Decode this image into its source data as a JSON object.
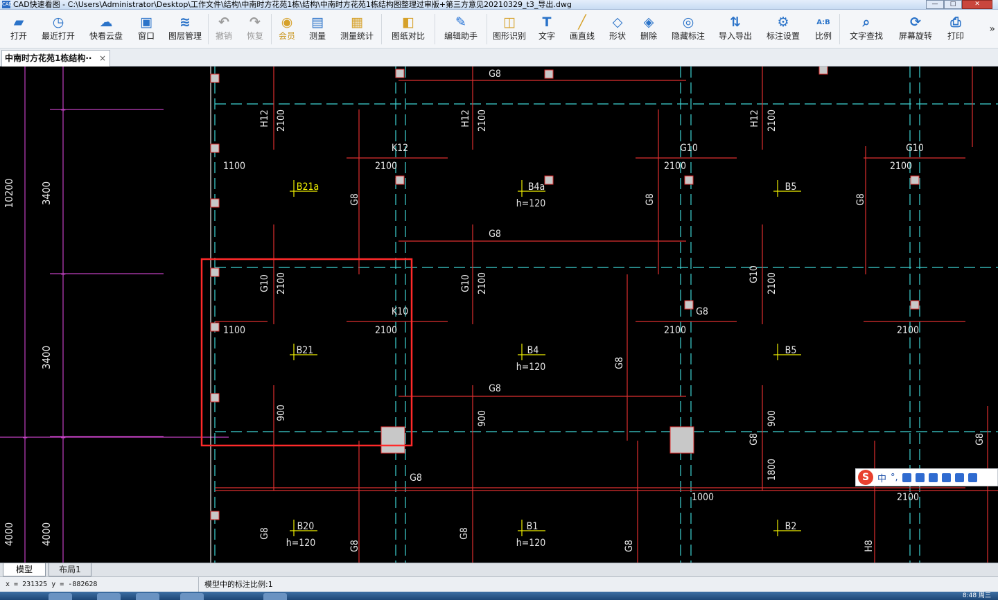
{
  "window": {
    "title": "CAD快速看图 - C:\\Users\\Administrator\\Desktop\\工作文件\\结构\\中南时方花苑1栋\\结构\\中南时方花苑1栋结构图整理过审版+第三方意见20210329_t3_导出.dwg",
    "app_icon": "CAD",
    "minimize": "—",
    "maximize": "□",
    "close": "✕"
  },
  "toolbar": [
    {
      "id": "open",
      "label": "打开",
      "icon": "folder-icon",
      "color": "#2a73c9"
    },
    {
      "id": "recent",
      "label": "最近打开",
      "icon": "history-icon",
      "color": "#2a73c9"
    },
    {
      "id": "cloud",
      "label": "快看云盘",
      "icon": "cloud-icon",
      "color": "#2a73c9"
    },
    {
      "id": "window",
      "label": "窗口",
      "icon": "window-icon",
      "color": "#2a73c9"
    },
    {
      "id": "layers",
      "label": "图层管理",
      "icon": "layers-icon",
      "color": "#2a73c9"
    },
    {
      "id": "undo",
      "label": "撤销",
      "icon": "undo-icon",
      "color": "#9a9a9a",
      "disabled": true
    },
    {
      "id": "redo",
      "label": "恢复",
      "icon": "redo-icon",
      "color": "#9a9a9a",
      "disabled": true
    },
    {
      "id": "vip",
      "label": "会员",
      "icon": "vip-icon",
      "color": "#d6a12a"
    },
    {
      "id": "measure",
      "label": "测量",
      "icon": "ruler-icon",
      "color": "#2a73c9"
    },
    {
      "id": "measure-stats",
      "label": "测量统计",
      "icon": "stats-icon",
      "color": "#d6a12a"
    },
    {
      "id": "compare",
      "label": "图纸对比",
      "icon": "compare-icon",
      "color": "#d6a12a"
    },
    {
      "id": "edit-helper",
      "label": "编辑助手",
      "icon": "edit-helper-icon",
      "color": "#1f6fd6"
    },
    {
      "id": "shape-recog",
      "label": "图形识别",
      "icon": "shape-recognize-icon",
      "color": "#d6a12a"
    },
    {
      "id": "text",
      "label": "文字",
      "icon": "text-icon",
      "color": "#2a73c9"
    },
    {
      "id": "line",
      "label": "画直线",
      "icon": "line-icon",
      "color": "#d6a12a"
    },
    {
      "id": "shape",
      "label": "形状",
      "icon": "shape-icon",
      "color": "#2a73c9"
    },
    {
      "id": "delete",
      "label": "删除",
      "icon": "eraser-icon",
      "color": "#2a73c9"
    },
    {
      "id": "hide-marks",
      "label": "隐藏标注",
      "icon": "eye-hide-icon",
      "color": "#2a73c9"
    },
    {
      "id": "import-export",
      "label": "导入导出",
      "icon": "import-export-icon",
      "color": "#2a73c9"
    },
    {
      "id": "mark-settings",
      "label": "标注设置",
      "icon": "mark-settings-icon",
      "color": "#2a73c9"
    },
    {
      "id": "ratio",
      "label": "比例",
      "icon": "ratio-icon",
      "color": "#2a73c9"
    },
    {
      "id": "text-find",
      "label": "文字查找",
      "icon": "text-search-icon",
      "color": "#2a73c9"
    },
    {
      "id": "rotate",
      "label": "屏幕旋转",
      "icon": "rotate-screen-icon",
      "color": "#2a73c9"
    },
    {
      "id": "print",
      "label": "打印",
      "icon": "print-icon",
      "color": "#2a73c9"
    }
  ],
  "toolbar_overflow": "»",
  "document_tab": {
    "label": "中南时方花苑1栋结构··",
    "close": "×"
  },
  "drawing": {
    "dimensions": [
      "10200",
      "3400",
      "3400",
      "4000",
      "4000"
    ],
    "labels": [
      "G8",
      "H12",
      "2100",
      "H12",
      "2100",
      "H12",
      "2100",
      "K12",
      "2100",
      "G10",
      "2100",
      "G10",
      "2100",
      "1100",
      "B21a",
      "G8",
      "B4a",
      "h=120",
      "G8",
      "B5",
      "G8",
      "G8",
      "G10",
      "2100",
      "G10",
      "2100",
      "G10",
      "2100",
      "K10",
      "2100",
      "G8",
      "2100",
      "2100",
      "1100",
      "B21",
      "B4",
      "h=120",
      "G8",
      "B5",
      "900",
      "G8",
      "900",
      "900",
      "G8",
      "G8",
      "G8",
      "1800",
      "G8",
      "1000",
      "2100",
      "B20",
      "h=120",
      "B1",
      "h=120",
      "B2",
      "G8",
      "G8",
      "G8",
      "H8"
    ]
  },
  "ime": {
    "logo": "S",
    "mode": "中",
    "punct": "°,"
  },
  "layout_tabs": [
    "模型",
    "布局1"
  ],
  "status": {
    "coords": "x = 231325  y = -882628",
    "scale_text": "模型中的标注比例:1"
  },
  "taskbar": {
    "clock": "8:48 周三"
  }
}
